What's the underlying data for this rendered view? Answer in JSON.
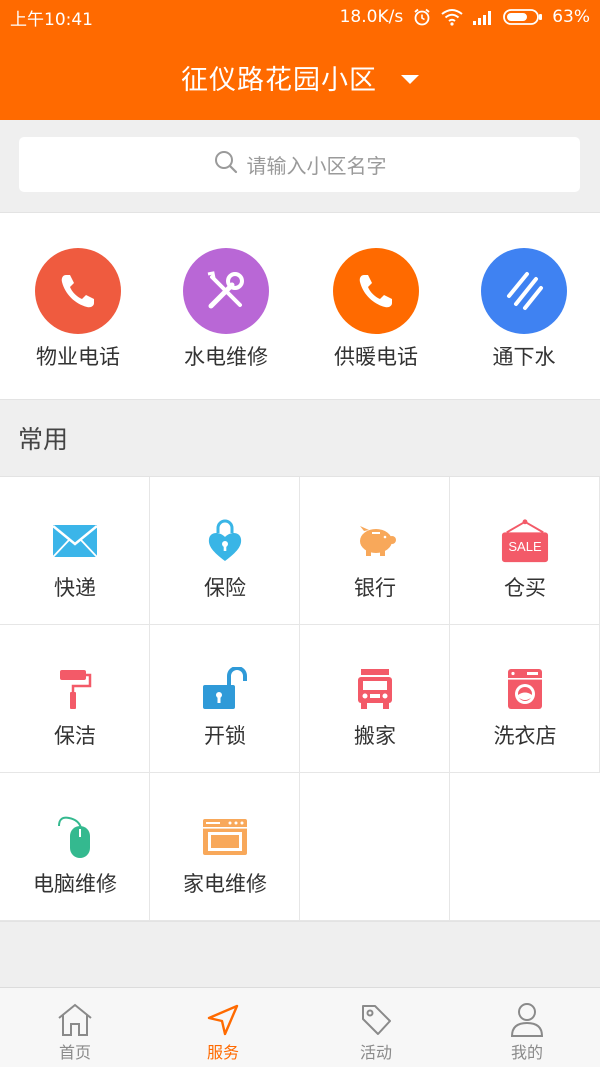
{
  "status_bar": {
    "time": "上午10:41",
    "speed": "18.0K/s",
    "battery": "63%",
    "icons": [
      "alarm-icon",
      "wifi-icon",
      "signal-icon",
      "battery-icon"
    ]
  },
  "header": {
    "title": "征仪路花园小区",
    "dropdown_icon": "caret-down-icon"
  },
  "search": {
    "placeholder": "请输入小区名字",
    "icon": "search-icon"
  },
  "quick_services": [
    {
      "label": "物业电话",
      "icon": "phone-icon",
      "color": "#ef5b3f"
    },
    {
      "label": "水电维修",
      "icon": "wrench-screwdriver-icon",
      "color": "#b967d6"
    },
    {
      "label": "供暖电话",
      "icon": "phone-icon",
      "color": "#ff6a00"
    },
    {
      "label": "通下水",
      "icon": "drain-icon",
      "color": "#3f82f2"
    }
  ],
  "common": {
    "title": "常用",
    "items": [
      {
        "label": "快递",
        "icon": "envelope-icon",
        "color": "#3bb5e9"
      },
      {
        "label": "保险",
        "icon": "heart-lock-icon",
        "color": "#39b5e6"
      },
      {
        "label": "银行",
        "icon": "piggy-bank-icon",
        "color": "#f8a85a"
      },
      {
        "label": "仓买",
        "icon": "sale-sign-icon",
        "color": "#f35a68",
        "badge": "SALE"
      },
      {
        "label": "保洁",
        "icon": "paint-roller-icon",
        "color": "#f35a68"
      },
      {
        "label": "开锁",
        "icon": "unlock-icon",
        "color": "#2f9ad8"
      },
      {
        "label": "搬家",
        "icon": "truck-icon",
        "color": "#f35a68"
      },
      {
        "label": "洗衣店",
        "icon": "washing-machine-icon",
        "color": "#f35a68"
      },
      {
        "label": "电脑维修",
        "icon": "mouse-icon",
        "color": "#34b98f"
      },
      {
        "label": "家电维修",
        "icon": "oven-icon",
        "color": "#f8a85a"
      }
    ]
  },
  "tab_bar": {
    "tabs": [
      {
        "label": "首页",
        "icon": "home-icon",
        "active": false
      },
      {
        "label": "服务",
        "icon": "navigation-arrow-icon",
        "active": true
      },
      {
        "label": "活动",
        "icon": "tag-icon",
        "active": false
      },
      {
        "label": "我的",
        "icon": "person-icon",
        "active": false
      }
    ],
    "active_color": "#ff6a00",
    "inactive_color": "#8a8a8a"
  },
  "theme": {
    "primary": "#ff6a00",
    "background": "#efefef"
  }
}
